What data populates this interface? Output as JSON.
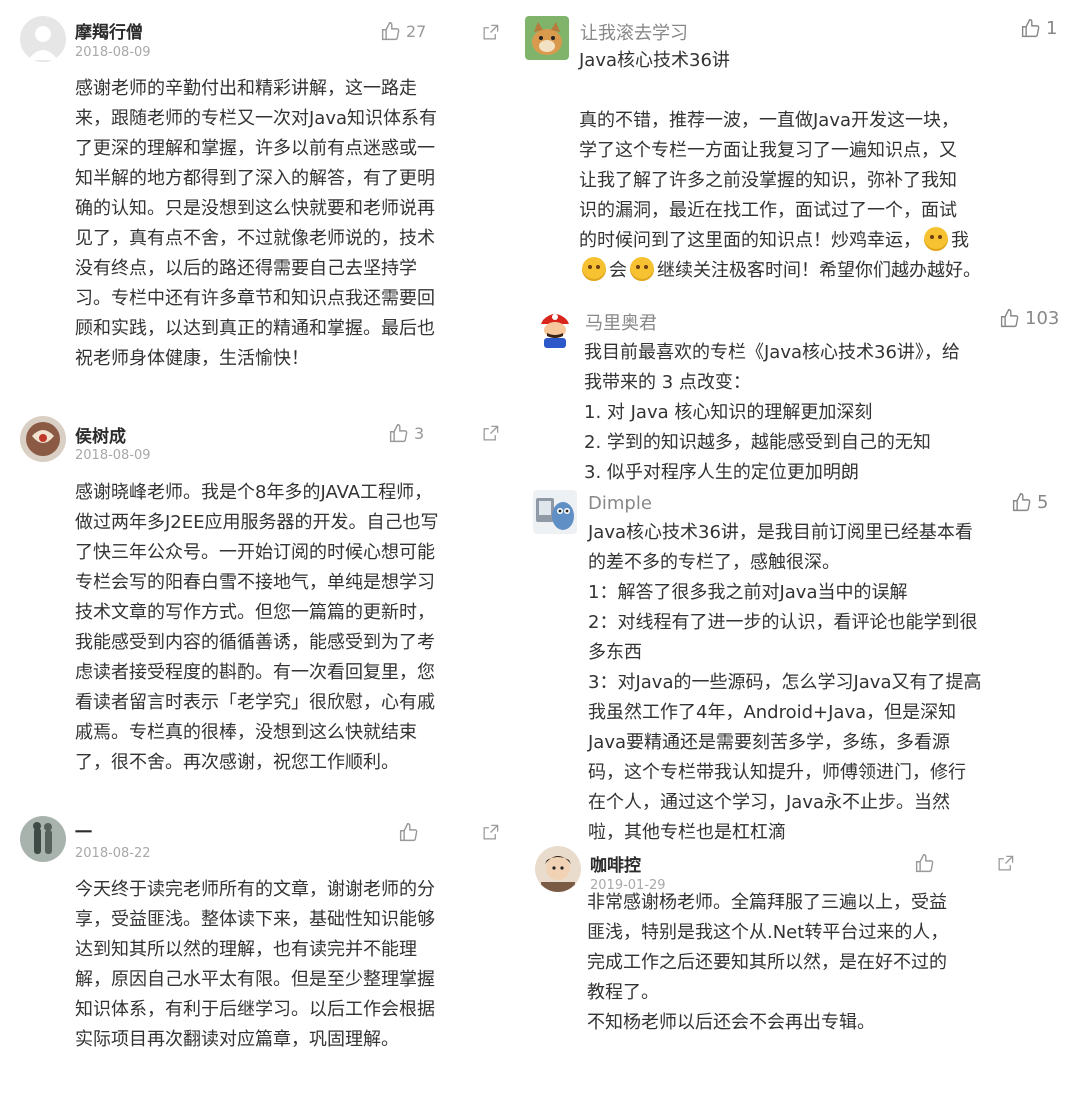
{
  "left": [
    {
      "name": "摩羯行僧",
      "date": "2018-08-09",
      "likes": "27",
      "lines": [
        "感谢老师的辛勤付出和精彩讲解，这一路走",
        "来，跟随老师的专栏又一次对Java知识体系有",
        "了更深的理解和掌握，许多以前有点迷惑或一",
        "知半解的地方都得到了深入的解答，有了更明",
        "确的认知。只是没想到这么快就要和老师说再",
        "见了，真有点不舍，不过就像老师说的，技术",
        "没有终点，以后的路还得需要自己去坚持学",
        "习。专栏中还有许多章节和知识点我还需要回",
        "顾和实践，以达到真正的精通和掌握。最后也",
        "祝老师身体健康，生活愉快！"
      ]
    },
    {
      "name": "侯树成",
      "date": "2018-08-09",
      "likes": "3",
      "lines": [
        "感谢晓峰老师。我是个8年多的JAVA工程师，",
        "做过两年多J2EE应用服务器的开发。自己也写",
        "了快三年公众号。一开始订阅的时候心想可能",
        "专栏会写的阳春白雪不接地气，单纯是想学习",
        "技术文章的写作方式。但您一篇篇的更新时，",
        "我能感受到内容的循循善诱，能感受到为了考",
        "虑读者接受程度的斟酌。有一次看回复里，您",
        "看读者留言时表示「老学究」很欣慰，心有戚",
        "戚焉。专栏真的很棒，没想到这么快就结束",
        "了，很不舍。再次感谢，祝您工作顺利。"
      ]
    },
    {
      "name": "一",
      "date": "2018-08-22",
      "likes": "",
      "lines": [
        "今天终于读完老师所有的文章，谢谢老师的分",
        "享，受益匪浅。整体读下来，基础性知识能够",
        "达到知其所以然的理解，也有读完并不能理",
        "解，原因自己水平太有限。但是至少整理掌握",
        "知识体系，有利于后继学习。以后工作会根据",
        "实际项目再次翻读对应篇章，巩固理解。"
      ]
    }
  ],
  "right": [
    {
      "name": "让我滚去学习",
      "likes": "1",
      "title": "Java核心技术36讲",
      "lines": [
        "真的不错，推荐一波，一直做Java开发这一块，",
        "学了这个专栏一方面让我复习了一遍知识点，又",
        "让我了解了许多之前没掌握的知识，弥补了我知",
        "识的漏洞，最近在找工作，面试过了一个，面试",
        "的时候问到了这里面的知识点！炒鸡幸运，",
        "我",
        "会",
        "继续关注极客时间！希望你们越办越好。"
      ]
    },
    {
      "name": "马里奥君",
      "likes": "103",
      "lines": [
        "我目前最喜欢的专栏《Java核心技术36讲》，给",
        "我带来的 3 点改变：",
        "1. 对 Java 核心知识的理解更加深刻",
        "2. 学到的知识越多，越能感受到自己的无知",
        "3. 似乎对程序人生的定位更加明朗"
      ]
    },
    {
      "name": "Dimple",
      "likes": "5",
      "lines": [
        "Java核心技术36讲，是我目前订阅里已经基本看",
        "的差不多的专栏了，感触很深。",
        "1：解答了很多我之前对Java当中的误解",
        "2：对线程有了进一步的认识，看评论也能学到很",
        "多东西",
        "3：对Java的一些源码，怎么学习Java又有了提高",
        "我虽然工作了4年，Android+Java，但是深知",
        "Java要精通还是需要刻苦多学，多练，多看源",
        "码，这个专栏带我认知提升，师傅领进门，修行",
        "在个人，通过这个学习，Java永不止步。当然",
        "啦，其他专栏也是杠杠滴"
      ]
    },
    {
      "name": "咖啡控",
      "date": "2019-01-29",
      "likes": "",
      "lines": [
        "非常感谢杨老师。全篇拜服了三遍以上，受益",
        "匪浅，特别是我这个从.Net转平台过来的人，",
        "完成工作之后还要知其所以然，是在好不过的",
        "教程了。",
        "不知杨老师以后还会不会再出专辑。"
      ]
    }
  ]
}
